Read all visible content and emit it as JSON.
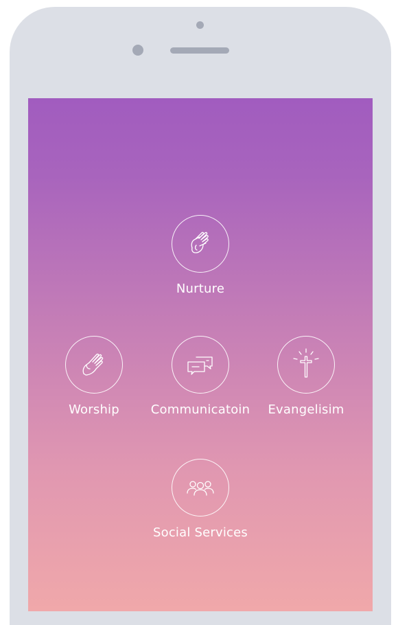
{
  "menu": {
    "nurture": {
      "label": "Nurture",
      "icon": "clasped-hands-icon"
    },
    "worship": {
      "label": "Worship",
      "icon": "praying-hands-icon"
    },
    "communication": {
      "label": "Communicatoin",
      "icon": "chat-bubbles-icon"
    },
    "evangelism": {
      "label": "Evangelisim",
      "icon": "cross-icon"
    },
    "social_services": {
      "label": "Social Services",
      "icon": "people-group-icon"
    }
  },
  "colors": {
    "gradient_top": "#a15cbf",
    "gradient_bottom": "#f0a8aa",
    "phone_frame": "#dcdfe6",
    "phone_details": "#a4a9b6",
    "icon_stroke": "#ffffff"
  }
}
